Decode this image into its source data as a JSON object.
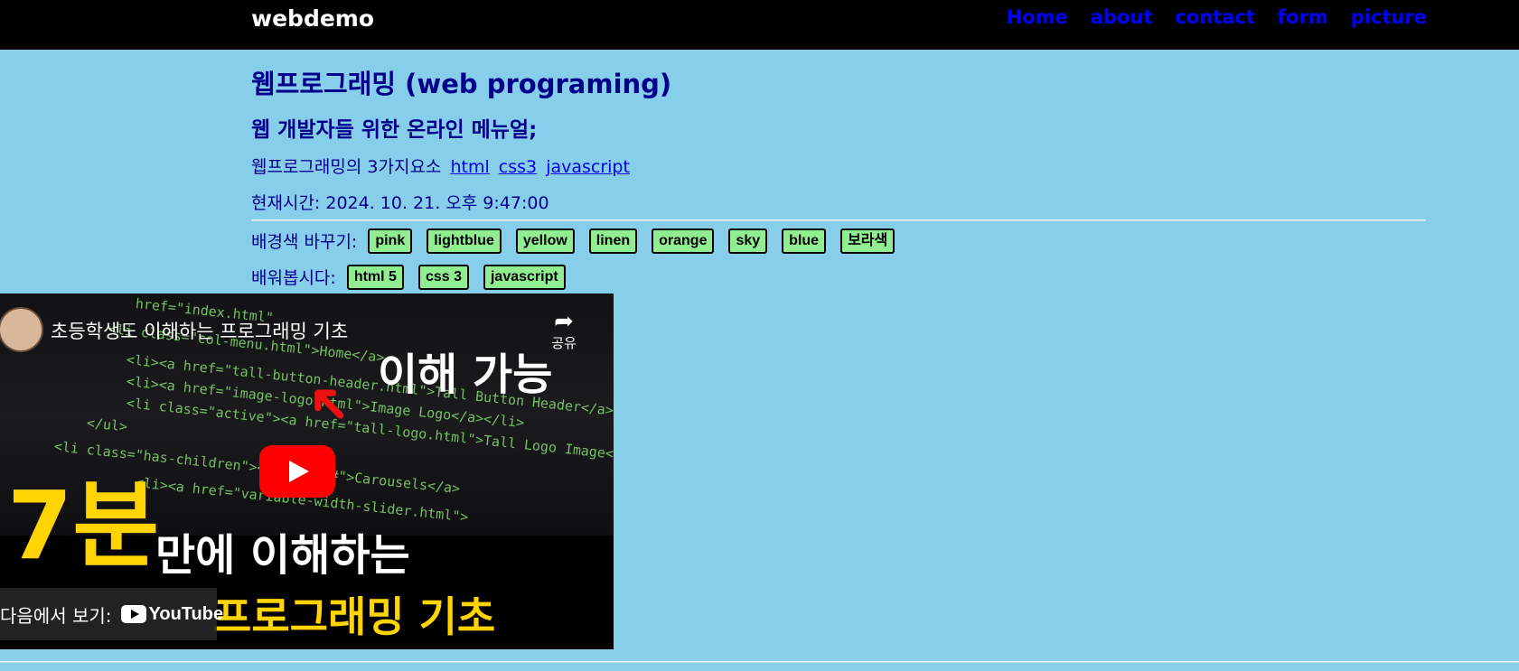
{
  "header": {
    "brand": "webdemo",
    "nav": [
      "Home",
      "about",
      "contact",
      "form",
      "picture"
    ]
  },
  "main": {
    "title": "웹프로그래밍 (web programing)",
    "subtitle": "웹 개발자들 위한 온라인 메뉴얼;",
    "intro_text": "웹프로그래밍의 3가지요소",
    "intro_links": [
      "html",
      "css3",
      "javascript"
    ],
    "time_text": "현재시간: 2024. 10. 21. 오후 9:47:00",
    "bg_label": "배경색 바꾸기:",
    "bg_buttons": [
      "pink",
      "lightblue",
      "yellow",
      "linen",
      "orange",
      "sky",
      "blue",
      "보라색"
    ],
    "learn_label": "배워봅시다:",
    "learn_buttons": [
      "html 5",
      "css 3",
      "javascript"
    ]
  },
  "video": {
    "title": "초등학생도 이해하는 프로그래밍 기초",
    "share_label": "공유",
    "thumbnail_line1": "이해 가능",
    "thumbnail_big": "7분",
    "thumbnail_mid": "만에 이해하는",
    "thumbnail_last": "프로그래밍 기초",
    "watch_on": "다음에서 보기:",
    "youtube_logo": "YouTube",
    "code_lines": [
      "href=\"index.html\"",
      "<li class=\"col-menu.html\">Home</a>",
      "<li><a href=\"tall-button-header.html\">Tall Button Header</a>",
      "<li><a href=\"image-logo.html\">Image Logo</a></li>",
      "<li class=\"active\"><a href=\"tall-logo.html\">Tall Logo Image</a>",
      "</ul>",
      "<li class=\"has-children\"><a href=\"#\">Carousels</a>",
      "<li><a href=\"variable-width-slider.html\">"
    ]
  }
}
